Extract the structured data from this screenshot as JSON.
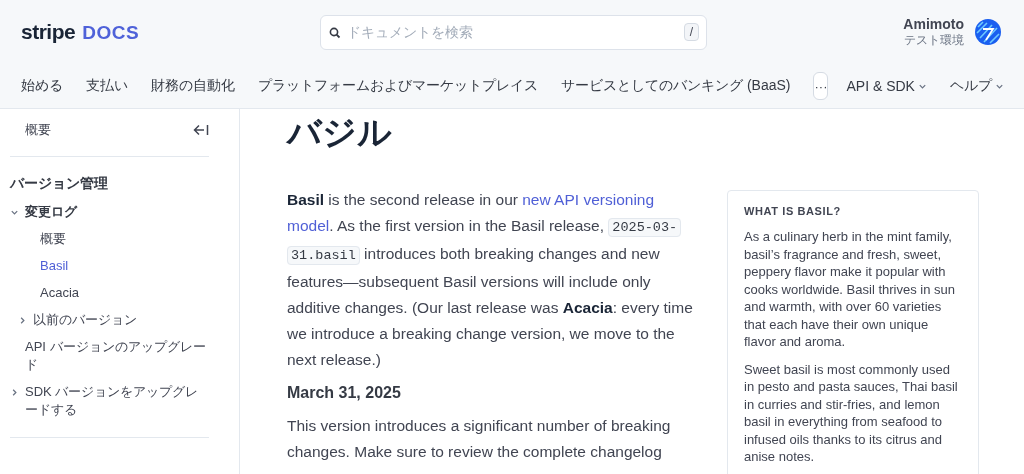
{
  "header": {
    "logo": {
      "brand": "stripe",
      "product": "DOCS"
    },
    "search": {
      "placeholder": "ドキュメントを検索",
      "shortcut": "/"
    },
    "account": {
      "name": "Amimoto",
      "environment": "テスト環境"
    }
  },
  "nav": [
    {
      "label": "始める",
      "kind": "link"
    },
    {
      "label": "支払い",
      "kind": "link"
    },
    {
      "label": "財務の自動化",
      "kind": "link"
    },
    {
      "label": "プラットフォームおよびマーケットプレイス",
      "kind": "link"
    },
    {
      "label": "サービスとしてのバンキング (BaaS)",
      "kind": "link"
    },
    {
      "label": "···",
      "kind": "more"
    },
    {
      "label": "API & SDK",
      "kind": "menu"
    },
    {
      "label": "ヘルプ",
      "kind": "menu"
    }
  ],
  "sidebar": {
    "overview": "概要",
    "section_title": "バージョン管理",
    "items": [
      {
        "label": "変更ログ",
        "expanded": true,
        "selected": false,
        "children": [
          {
            "label": "概要",
            "selected": false
          },
          {
            "label": "Basil",
            "selected": true
          },
          {
            "label": "Acacia",
            "selected": false
          },
          {
            "label": "以前のバージョン",
            "expanded": false,
            "selected": false
          }
        ]
      },
      {
        "label": "API バージョンのアップグレード",
        "selected": false
      },
      {
        "label": "SDK バージョンをアップグレードする",
        "expanded": false,
        "selected": false
      }
    ]
  },
  "article": {
    "title": "バジル",
    "intro": [
      {
        "kind": "bold",
        "text": "Basil"
      },
      {
        "kind": "text",
        "text": " is the second release in our "
      },
      {
        "kind": "link",
        "lines": [
          "new API versioning",
          "model"
        ]
      },
      {
        "kind": "text",
        "text": ". As the first version in the Basil release, "
      },
      {
        "kind": "code",
        "lines": [
          "2025-03-",
          "31.basil"
        ]
      },
      {
        "kind": "text",
        "text": " introduces both breaking changes and new features—subsequent Basil versions will include only additive changes. (Our last release was "
      },
      {
        "kind": "bold",
        "text": "Acacia"
      },
      {
        "kind": "text",
        "text": ": every time we introduce a breaking change version, we move to the next release.)"
      }
    ],
    "date": "March 31, 2025",
    "body": "This version introduces a significant number of breaking changes. Make sure to review the complete changelog"
  },
  "aside": {
    "title": "WHAT IS BASIL?",
    "paragraphs": [
      "As a culinary herb in the mint family, basil’s fragrance and fresh, sweet, peppery flavor make it popular with cooks worldwide. Basil thrives in sun and warmth, with over 60 varieties that each have their own unique flavor and aroma.",
      "Sweet basil is most commonly used in pesto and pasta sauces, Thai basil in curries and stir-fries, and lemon basil in everything from seafood to infused oils thanks to its citrus and anise notes."
    ]
  }
}
